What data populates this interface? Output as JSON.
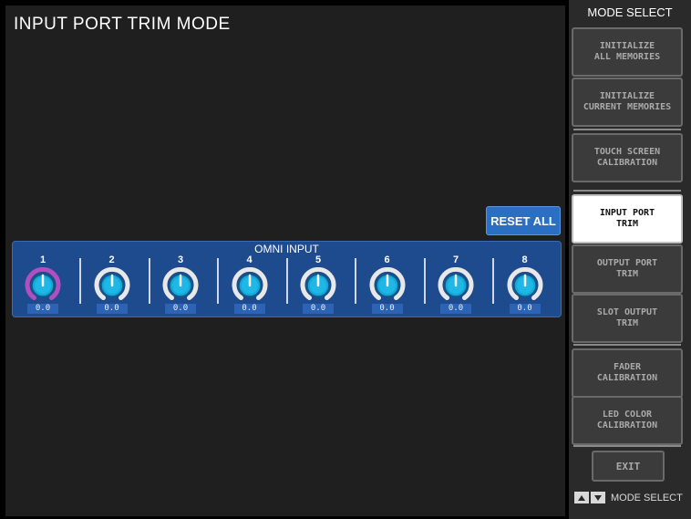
{
  "title": "INPUT PORT TRIM MODE",
  "reset_all_label": "RESET ALL",
  "omni": {
    "label": "OMNI INPUT",
    "channels": [
      {
        "num": "1",
        "value": "0.0",
        "selected": true
      },
      {
        "num": "2",
        "value": "0.0"
      },
      {
        "num": "3",
        "value": "0.0"
      },
      {
        "num": "4",
        "value": "0.0"
      },
      {
        "num": "5",
        "value": "0.0"
      },
      {
        "num": "6",
        "value": "0.0"
      },
      {
        "num": "7",
        "value": "0.0"
      },
      {
        "num": "8",
        "value": "0.0"
      }
    ]
  },
  "side": {
    "title": "MODE SELECT",
    "buttons": [
      {
        "label": "INITIALIZE\nALL MEMORIES"
      },
      {
        "label": "INITIALIZE\nCURRENT MEMORIES"
      },
      {
        "label": "TOUCH SCREEN\nCALIBRATION"
      },
      {
        "label": "INPUT PORT\nTRIM",
        "active": true
      },
      {
        "label": "OUTPUT PORT\nTRIM"
      },
      {
        "label": "SLOT OUTPUT\nTRIM"
      },
      {
        "label": "FADER\nCALIBRATION"
      },
      {
        "label": "LED COLOR\nCALIBRATION"
      }
    ],
    "exit_label": "EXIT",
    "nav_label": "MODE SELECT"
  },
  "colors": {
    "panel_blue": "#1e4a8e",
    "knob_cyan": "#13a8d8",
    "selected_ring": "#b04fc0",
    "active_button": "#ffffff"
  },
  "icons": [
    "up-arrow-icon",
    "down-arrow-icon"
  ]
}
